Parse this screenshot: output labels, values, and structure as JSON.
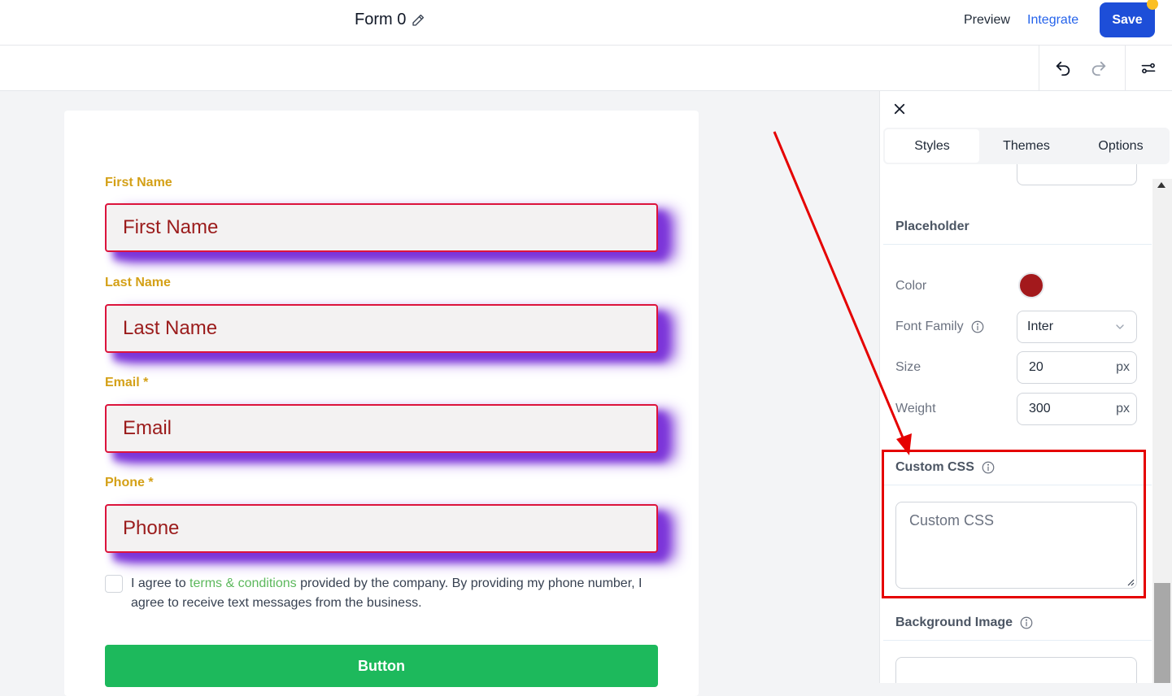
{
  "header": {
    "form_title": "Form 0",
    "preview_label": "Preview",
    "integrate_label": "Integrate",
    "save_label": "Save"
  },
  "form": {
    "fields": [
      {
        "label": "First Name",
        "placeholder": "First Name"
      },
      {
        "label": "Last Name",
        "placeholder": "Last Name"
      },
      {
        "label": "Email *",
        "placeholder": "Email"
      },
      {
        "label": "Phone *",
        "placeholder": "Phone"
      }
    ],
    "terms_prefix": "I agree to ",
    "terms_link": "terms & conditions",
    "terms_suffix": " provided by the company. By providing my phone number, I agree to receive text messages from the business.",
    "button_label": "Button"
  },
  "panel": {
    "tabs": [
      "Styles",
      "Themes",
      "Options"
    ],
    "active_tab": "Styles",
    "placeholder_section": "Placeholder",
    "color_label": "Color",
    "color_value": "#a3191c",
    "font_family_label": "Font Family",
    "font_family_value": "Inter",
    "size_label": "Size",
    "size_value": "20",
    "size_unit": "px",
    "weight_label": "Weight",
    "weight_value": "300",
    "weight_unit": "px",
    "custom_css_section": "Custom CSS",
    "custom_css_placeholder": "Custom CSS",
    "background_image_section": "Background Image"
  },
  "colors": {
    "primary": "#1d4ed8",
    "label": "#d4a017",
    "input_border": "#dc143c",
    "input_shadow": "#7c35d9",
    "submit": "#1db95c",
    "annotation": "#e50000"
  }
}
